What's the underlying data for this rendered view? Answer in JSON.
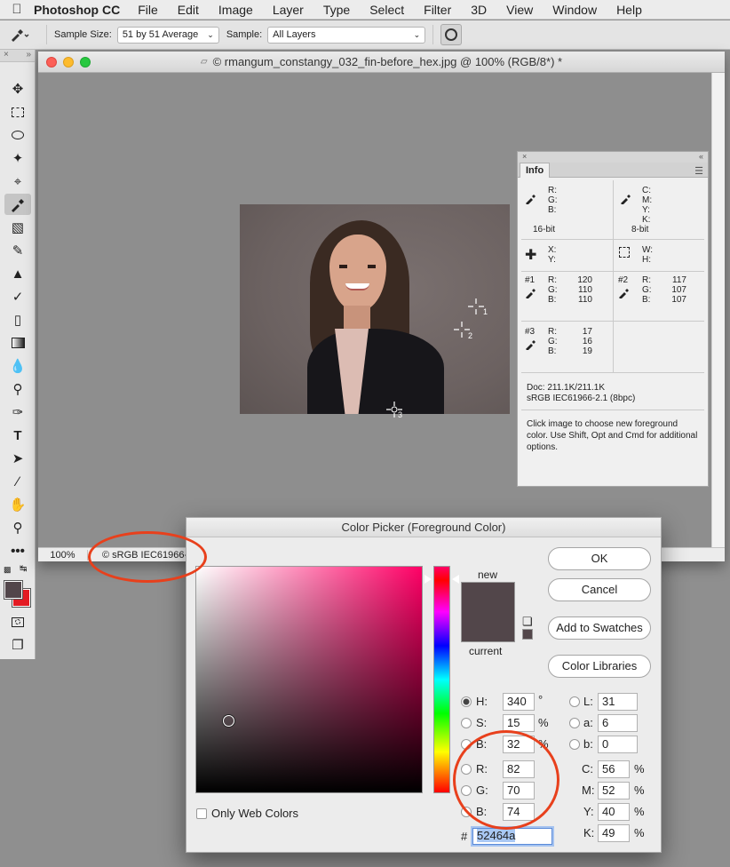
{
  "menubar": {
    "app": "Photoshop CC",
    "items": [
      "File",
      "Edit",
      "Image",
      "Layer",
      "Type",
      "Select",
      "Filter",
      "3D",
      "View",
      "Window",
      "Help"
    ]
  },
  "options": {
    "sample_size_label": "Sample Size:",
    "sample_size_value": "51 by 51 Average",
    "sample_label": "Sample:",
    "sample_value": "All Layers"
  },
  "document": {
    "title": "© rmangum_constangy_032_fin-before_hex.jpg @ 100% (RGB/8*) *",
    "zoom": "100%",
    "status": "© sRGB IEC61966-",
    "samplers": [
      "1",
      "2",
      "3"
    ]
  },
  "info_panel": {
    "tab": "Info",
    "rgb_labels": [
      "R:",
      "G:",
      "B:"
    ],
    "cmyk_labels": [
      "C:",
      "M:",
      "Y:",
      "K:"
    ],
    "bit16": "16-bit",
    "bit8": "8-bit",
    "xy_labels": [
      "X:",
      "Y:"
    ],
    "wh_labels": [
      "W:",
      "H:"
    ],
    "sampler1": {
      "label": "#1",
      "r": "120",
      "g": "110",
      "b": "110"
    },
    "sampler2": {
      "label": "#2",
      "r": "117",
      "g": "107",
      "b": "107"
    },
    "sampler3": {
      "label": "#3",
      "r": "17",
      "g": "16",
      "b": "19"
    },
    "doc_size": "Doc: 211.1K/211.1K",
    "profile": "sRGB IEC61966-2.1 (8bpc)",
    "hint": "Click image to choose new foreground color.  Use Shift, Opt and Cmd for additional options."
  },
  "color_picker": {
    "title": "Color Picker (Foreground Color)",
    "new_label": "new",
    "current_label": "current",
    "new_color": "#52464a",
    "current_color": "#52464a",
    "buttons": {
      "ok": "OK",
      "cancel": "Cancel",
      "add": "Add to Swatches",
      "libraries": "Color Libraries"
    },
    "fields": {
      "H": "340",
      "S": "15",
      "B": "32",
      "R": "82",
      "G": "70",
      "Bv": "74",
      "L": "31",
      "a": "6",
      "b": "0",
      "C": "56",
      "M": "52",
      "Y": "40",
      "K": "49"
    },
    "labels": {
      "H": "H:",
      "S": "S:",
      "B": "B:",
      "R": "R:",
      "G": "G:",
      "Bv": "B:",
      "L": "L:",
      "a": "a:",
      "b": "b:",
      "C": "C:",
      "M": "M:",
      "Y": "Y:",
      "K": "K:",
      "deg": "°",
      "pct": "%",
      "hash": "#"
    },
    "hex": "52464a",
    "web_colors": "Only Web Colors"
  },
  "colors": {
    "foreground": "#52464a",
    "background": "#e31b23",
    "annotation": "#e8401c"
  }
}
